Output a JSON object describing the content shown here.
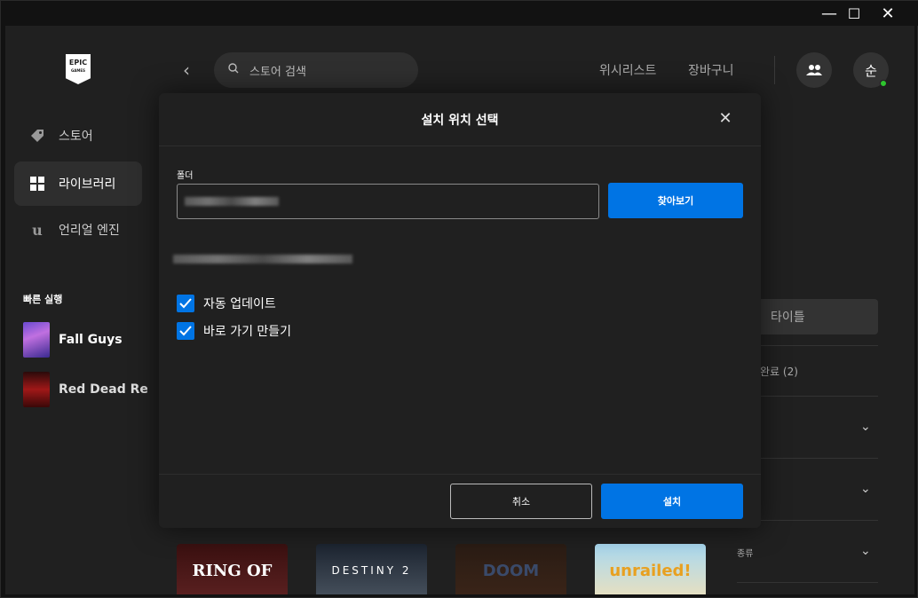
{
  "window": {
    "minimize": "—",
    "maximize": "☐",
    "close": "✕"
  },
  "sidebar": {
    "logo_top": "EPIC",
    "logo_bottom": "GAMES",
    "items": [
      {
        "label": "스토어",
        "icon": "tag-icon"
      },
      {
        "label": "라이브러리",
        "icon": "grid-icon",
        "active": true
      },
      {
        "label": "언리얼 엔진",
        "icon": "unreal-icon"
      }
    ],
    "quick_launch_title": "빠른 실행",
    "quick_launch": [
      {
        "label": "Fall Guys"
      },
      {
        "label": "Red Dead Re"
      }
    ]
  },
  "topbar": {
    "back": "‹",
    "search_placeholder": "스토어 검색",
    "wishlist": "위시리스트",
    "cart": "장바구니",
    "avatar_initial": "순"
  },
  "filters": {
    "title_placeholder": "타이틀",
    "installed": "완료 (2)",
    "genre": "종류"
  },
  "tiles": [
    {
      "label": "RING OF"
    },
    {
      "label": "DESTINY 2"
    },
    {
      "label": "DOOM"
    },
    {
      "label": "unrailed!"
    }
  ],
  "modal": {
    "title": "설치 위치 선택",
    "close": "✕",
    "folder_label": "폴더",
    "browse": "찾아보기",
    "auto_update": "자동 업데이트",
    "shortcut": "바로 가기 만들기",
    "cancel": "취소",
    "install": "설치"
  },
  "colors": {
    "accent": "#0074e4",
    "background": "#202020",
    "online": "#2ec52e"
  }
}
